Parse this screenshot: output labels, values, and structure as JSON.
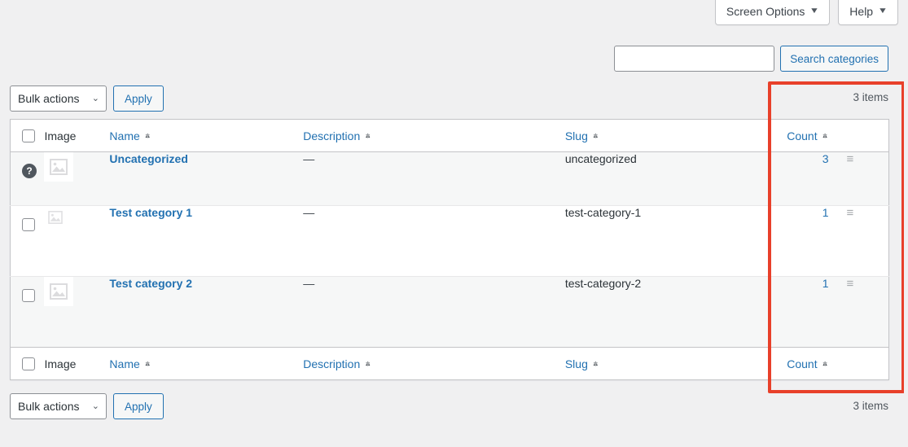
{
  "meta_bar": {
    "screen_options_label": "Screen Options",
    "help_label": "Help",
    "caret": "▼"
  },
  "search": {
    "value": "",
    "placeholder": "",
    "button_label": "Search categories"
  },
  "tablenav_top": {
    "bulk_actions_label": "Bulk actions",
    "chevron": "⌄",
    "apply_label": "Apply",
    "items_count": "3 items"
  },
  "tablenav_bottom": {
    "bulk_actions_label": "Bulk actions",
    "chevron": "⌄",
    "apply_label": "Apply",
    "items_count": "3 items"
  },
  "table": {
    "columns": {
      "image": "Image",
      "name": "Name",
      "description": "Description",
      "slug": "Slug",
      "count": "Count"
    },
    "sort_up": "▲",
    "sort_down": "▼",
    "rows": [
      {
        "select_marker": "?",
        "name": "Uncategorized",
        "description": "—",
        "slug": "uncategorized",
        "count": "3",
        "handle": "≡"
      },
      {
        "select_marker": "",
        "name": "Test category 1",
        "description": "—",
        "slug": "test-category-1",
        "count": "1",
        "handle": "≡"
      },
      {
        "select_marker": "",
        "name": "Test category 2",
        "description": "—",
        "slug": "test-category-2",
        "count": "1",
        "handle": "≡"
      }
    ]
  },
  "annotation": {
    "highlight_color": "#e8402a"
  }
}
